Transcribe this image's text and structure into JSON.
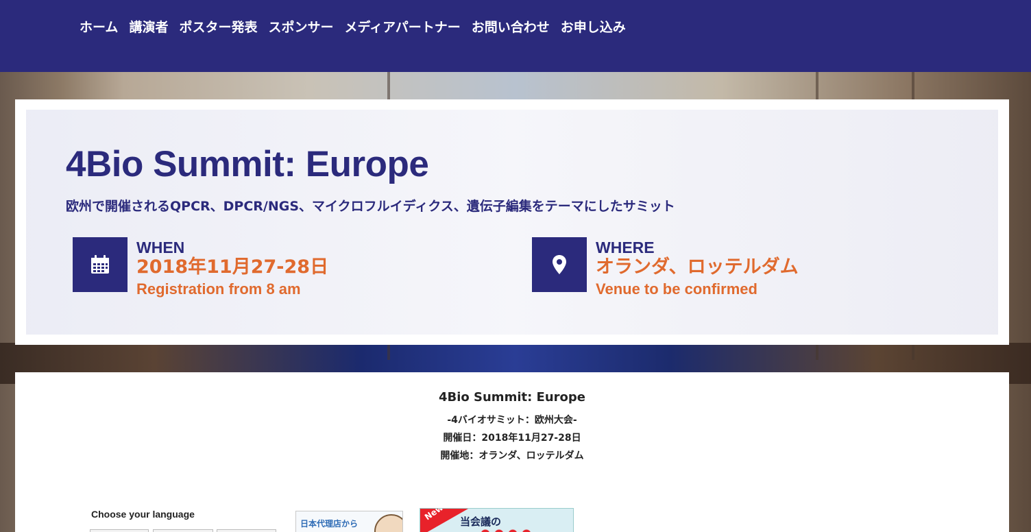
{
  "nav": {
    "items": [
      "ホーム",
      "講演者",
      "ポスター発表",
      "スポンサー",
      "メディアパートナー",
      "お問い合わせ",
      "お申し込み"
    ]
  },
  "event": {
    "title": "4Bio Summit: Europe",
    "subtitle": "欧州で開催されるQPCR、DPCR/NGS、マイクロフルイディクス、遺伝子編集をテーマにしたサミット",
    "when": {
      "label": "WHEN",
      "main": "2018年11月27-28日",
      "sub": "Registration from 8 am",
      "icon": "calendar-icon"
    },
    "where": {
      "label": "WHERE",
      "main": "オランダ、ロッテルダム",
      "sub": "Venue to be confirmed",
      "icon": "location-pin-icon"
    }
  },
  "content": {
    "title": "4Bio Summit: Europe",
    "line1": "-4バイオサミット：欧州大会-",
    "line2": "開催日：2018年11月27-28日",
    "line3": "開催地：オランダ、ロッテルダム",
    "language_label": "Choose your language",
    "agent_banner": "日本代理店から",
    "new_banner_ribbon": "New!",
    "new_banner_text": "当会議の"
  },
  "colors": {
    "brand": "#2b2a7c",
    "accent": "#e06a2e"
  }
}
